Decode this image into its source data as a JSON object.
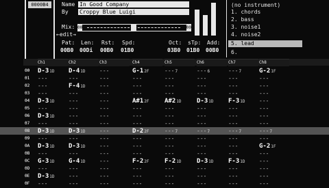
{
  "song": {
    "name_label": "Name",
    "name_value": "In Good Company",
    "by_label": "By",
    "by_value": "Croppy Blue Luigi",
    "mix_label": "Mix:",
    "edit_label": "←edit→",
    "mix_left": "00",
    "mix_right": "00",
    "top_left_code": "0000B4"
  },
  "params": [
    {
      "label": "Pat:",
      "value": "00B0"
    },
    {
      "label": "Len:",
      "value": "00Di"
    },
    {
      "label": "Rst:",
      "value": "00B0"
    },
    {
      "label": "Spd:",
      "value": "01B0"
    },
    {
      "label": "Oct:",
      "value": "03B0"
    },
    {
      "label": "sTp:",
      "value": "01B0"
    },
    {
      "label": "Add:",
      "value": "00B0"
    }
  ],
  "instruments": {
    "items": [
      {
        "num": "",
        "name": "(no instrument)"
      },
      {
        "num": "1.",
        "name": "chords"
      },
      {
        "num": "2.",
        "name": "bass"
      },
      {
        "num": "3.",
        "name": "noise1"
      },
      {
        "num": "4.",
        "name": "noise2"
      },
      {
        "num": "5.",
        "name": "lead"
      },
      {
        "num": "6.",
        "name": ""
      }
    ],
    "selected_index": 5
  },
  "channels": [
    {
      "label": "Ch1"
    },
    {
      "label": "Ch2"
    },
    {
      "label": "Ch3"
    },
    {
      "label": "Ch4"
    },
    {
      "label": "Ch5"
    },
    {
      "label": "Ch6"
    },
    {
      "label": "Ch7"
    },
    {
      "label": "Ch8"
    }
  ],
  "pattern": {
    "highlight_row": 8,
    "rows": [
      {
        "idx": "00",
        "cells": [
          "D-3",
          "D-4",
          "---",
          "G-1",
          "---",
          "---",
          "---",
          "G-2"
        ],
        "vals": [
          "1D",
          "1D",
          "",
          "2F",
          "7",
          "6",
          "7",
          "1F"
        ]
      },
      {
        "idx": "01",
        "cells": [
          "---",
          "---",
          "---",
          "---",
          "---",
          "---",
          "---",
          "---"
        ],
        "vals": [
          "",
          "",
          "",
          "",
          "",
          "",
          "",
          ""
        ]
      },
      {
        "idx": "02",
        "cells": [
          "---",
          "F-4",
          "---",
          "---",
          "---",
          "---",
          "---",
          "---"
        ],
        "vals": [
          "",
          "1D",
          "",
          "",
          "",
          "",
          "",
          ""
        ]
      },
      {
        "idx": "03",
        "cells": [
          "---",
          "---",
          "---",
          "---",
          "---",
          "---",
          "---",
          "---"
        ],
        "vals": [
          "",
          "",
          "",
          "",
          "",
          "",
          "",
          ""
        ]
      },
      {
        "idx": "04",
        "cells": [
          "D-3",
          "---",
          "---",
          "A#1",
          "A#2",
          "D-3",
          "F-3",
          "---"
        ],
        "vals": [
          "1D",
          "",
          "",
          "2F",
          "1D",
          "1D",
          "1D",
          ""
        ]
      },
      {
        "idx": "05",
        "cells": [
          "---",
          "---",
          "---",
          "---",
          "---",
          "---",
          "---",
          "---"
        ],
        "vals": [
          "",
          "",
          "",
          "",
          "",
          "",
          "",
          ""
        ]
      },
      {
        "idx": "06",
        "cells": [
          "D-3",
          "---",
          "---",
          "---",
          "---",
          "---",
          "---",
          "---"
        ],
        "vals": [
          "1D",
          "",
          "",
          "",
          "",
          "",
          "",
          ""
        ]
      },
      {
        "idx": "07",
        "cells": [
          "---",
          "---",
          "---",
          "---",
          "---",
          "---",
          "---",
          "---"
        ],
        "vals": [
          "",
          "",
          "",
          "",
          "",
          "",
          "",
          ""
        ]
      },
      {
        "idx": "08",
        "cells": [
          "D-3",
          "D-3",
          "---",
          "D-2",
          "---",
          "---",
          "---",
          "---"
        ],
        "vals": [
          "1D",
          "1D",
          "",
          "2F",
          "7",
          "7",
          "7",
          "7"
        ]
      },
      {
        "idx": "09",
        "cells": [
          "---",
          "---",
          "---",
          "---",
          "---",
          "---",
          "---",
          "---"
        ],
        "vals": [
          "",
          "",
          "",
          "",
          "",
          "",
          "",
          ""
        ]
      },
      {
        "idx": "0A",
        "cells": [
          "D-3",
          "D-3",
          "---",
          "---",
          "---",
          "---",
          "---",
          "G-2"
        ],
        "vals": [
          "1D",
          "1D",
          "",
          "",
          "",
          "",
          "",
          "1F"
        ]
      },
      {
        "idx": "0B",
        "cells": [
          "---",
          "---",
          "---",
          "---",
          "---",
          "---",
          "---",
          "---"
        ],
        "vals": [
          "",
          "",
          "",
          "",
          "",
          "",
          "",
          ""
        ]
      },
      {
        "idx": "0C",
        "cells": [
          "G-3",
          "G-4",
          "---",
          "F-2",
          "F-2",
          "D-3",
          "F-3",
          "---"
        ],
        "vals": [
          "1D",
          "1D",
          "",
          "2F",
          "1D",
          "1D",
          "1D",
          ""
        ]
      },
      {
        "idx": "0D",
        "cells": [
          "---",
          "---",
          "---",
          "---",
          "---",
          "---",
          "---",
          "---"
        ],
        "vals": [
          "",
          "",
          "",
          "",
          "",
          "",
          "",
          ""
        ]
      },
      {
        "idx": "0E",
        "cells": [
          "D-3",
          "---",
          "---",
          "---",
          "---",
          "---",
          "---",
          "---"
        ],
        "vals": [
          "1D",
          "",
          "",
          "",
          "",
          "",
          "",
          ""
        ]
      },
      {
        "idx": "0F",
        "cells": [
          "---",
          "---",
          "---",
          "---",
          "---",
          "---",
          "---",
          "---"
        ],
        "vals": [
          "",
          "",
          "",
          "",
          "",
          "",
          "",
          ""
        ]
      }
    ]
  },
  "row_gutter": [
    "00",
    "01",
    "02",
    "03",
    "04",
    "05",
    "06",
    "07",
    "08",
    "09",
    "0A",
    "0B",
    "0C",
    "0D",
    "0E",
    "0F"
  ]
}
